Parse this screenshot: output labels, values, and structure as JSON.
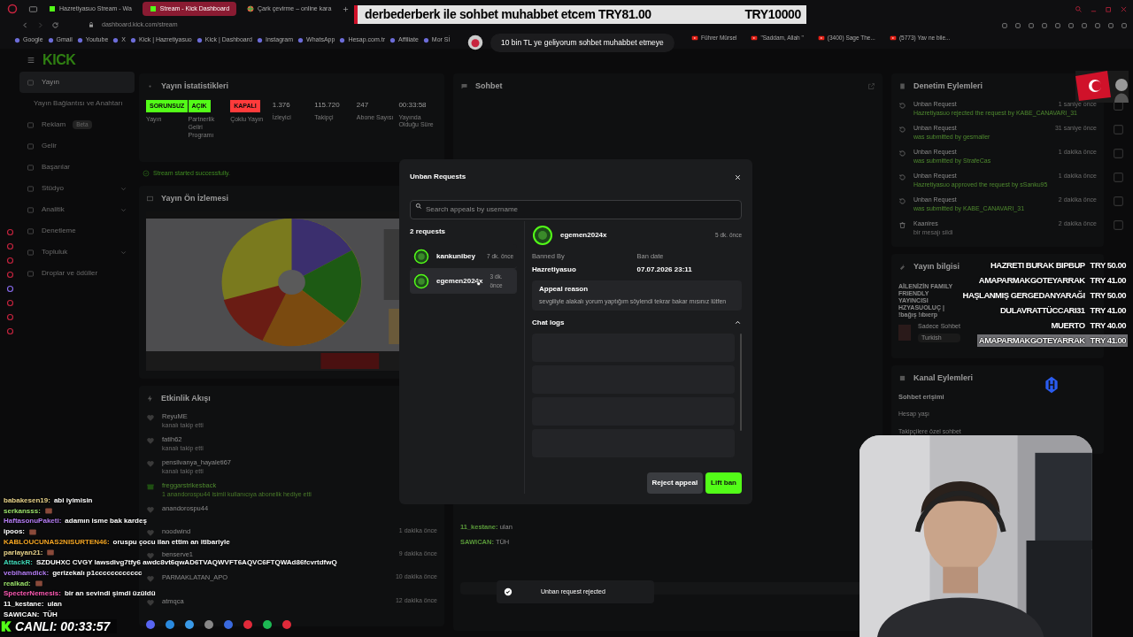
{
  "browser": {
    "tabs": [
      {
        "label": "Hazretiyasuo Stream - Wa",
        "selected": false
      },
      {
        "label": "Stream - Kick Dashboard",
        "selected": true
      },
      {
        "label": "Çark çevirme – online kara",
        "selected": false
      }
    ],
    "address": "dashboard.kick.com/stream",
    "bookmarks": [
      "Google",
      "Gmail",
      "Youtube",
      "X",
      "Kick | Hazretiyasuo",
      "Kick | Dashboard",
      "Instagram",
      "WhatsApp",
      "Hesap.com.tr",
      "Affiliate",
      "Mor Sİ"
    ],
    "video_bookmarks": [
      "Führer Mürsel",
      "\"Saddam, Allah \"",
      "(3400) Sage The...",
      "(5773) Yav ne bile..."
    ]
  },
  "dashboard": {
    "logo": "KICK",
    "sidebar": [
      {
        "label": "Yayın",
        "selected": true,
        "kind": "item"
      },
      {
        "label": "Yayın Bağlantısı ve Anahtarı",
        "selected": false,
        "kind": "sub"
      },
      {
        "label": "Reklam",
        "badge": "Beta",
        "selected": false,
        "kind": "item"
      },
      {
        "label": "Gelir",
        "selected": false,
        "kind": "item"
      },
      {
        "label": "Başarılar",
        "selected": false,
        "kind": "item"
      },
      {
        "label": "Stüdyo",
        "expanded": false,
        "selected": false,
        "kind": "item"
      },
      {
        "label": "Analitik",
        "expanded": false,
        "selected": false,
        "kind": "item"
      },
      {
        "label": "Denetleme",
        "selected": false,
        "kind": "item"
      },
      {
        "label": "Topluluk",
        "expanded": false,
        "selected": false,
        "kind": "item"
      },
      {
        "label": "Droplar ve ödüller",
        "selected": false,
        "kind": "item"
      }
    ],
    "stats": {
      "title": "Yayın İstatistikleri",
      "items": [
        {
          "kind": "badge",
          "value": "SORUNSUZ",
          "color": "#53fc18",
          "label": "Yayın"
        },
        {
          "kind": "badge",
          "value": "AÇIK",
          "color": "#53fc18",
          "label": "Partnerlik Geliri Programı"
        },
        {
          "kind": "badge",
          "value": "KAPALI",
          "color": "#ff3b3b",
          "label": "Çoklu Yayın"
        },
        {
          "kind": "number",
          "value": "1.376",
          "label": "İzleyici"
        },
        {
          "kind": "number",
          "value": "115.720",
          "label": "Takipçi"
        },
        {
          "kind": "number",
          "value": "247",
          "label": "Abone Sayısı"
        },
        {
          "kind": "number",
          "value": "00:33:58",
          "label": "Yayında Olduğu Süre"
        }
      ],
      "notice": "Stream started successfully."
    },
    "preview": {
      "title": "Yayın Ön İzlemesi",
      "kind": "picture"
    },
    "activity": {
      "title": "Etkinlik Akışı",
      "items": [
        {
          "kind": "follow",
          "name": "ReyuME",
          "text": "kanalı takip etti"
        },
        {
          "kind": "follow",
          "name": "fatih62",
          "text": "kanalı takip etti"
        },
        {
          "kind": "follow",
          "name": "pensilvanya_hayaleti67",
          "text": "kanalı takip etti"
        },
        {
          "kind": "gift",
          "name": "freggarstrikesback",
          "text": "1 anandorospu44 isimli kullanıcıya abonelik hediye etti"
        },
        {
          "kind": "follow",
          "name": "anandorospu44"
        },
        {
          "kind": "follow",
          "name": "noodwind",
          "time": "1 dakika önce"
        },
        {
          "kind": "follow",
          "name": "benserve1",
          "time": "9 dakika önce"
        },
        {
          "kind": "follow",
          "name": "PARMAKLATAN_APO",
          "time": "10 dakika önce"
        },
        {
          "kind": "follow",
          "name": "atmqca",
          "time": "12 dakika önce"
        }
      ]
    },
    "chat": {
      "title": "Sohbet",
      "messages": [
        {
          "user": "11_kestane:",
          "text": "ulan"
        },
        {
          "user": "SAWICAN:",
          "text": "TÜH"
        }
      ]
    },
    "moderation": {
      "title": "Denetim Eylemleri",
      "items": [
        {
          "kind": "unban",
          "title": "Unban Request",
          "text": "Hazretiyasuo rejected the request by KABE_CANAVARI_31",
          "time": "1 saniye önce"
        },
        {
          "kind": "unban",
          "title": "Unban Request",
          "text": "was submitted by gesmaller",
          "time": "31 saniye önce"
        },
        {
          "kind": "unban",
          "title": "Unban Request",
          "text": "was submitted by StrafeCas",
          "time": "1 dakika önce"
        },
        {
          "kind": "unban",
          "title": "Unban Request",
          "text": "Hazretiyasuo approved the request by sSanku95",
          "time": "1 dakika önce"
        },
        {
          "kind": "unban",
          "title": "Unban Request",
          "text": "was submitted by KABE_CANAVARI_31",
          "time": "2 dakika önce"
        },
        {
          "kind": "delete",
          "title": "Kaanires",
          "text": "bir mesajı sildi",
          "time": "2 dakika önce"
        }
      ]
    },
    "stream_info": {
      "title": "Yayın bilgisi",
      "stream_title": "AİLENİZİN FAMILY FRIENDLY YAYINCISI HZYASUOLUÇ | !bağış !ıbıerp",
      "category": "Sadece Sohbet",
      "tag": "Turkish"
    },
    "channel_actions": {
      "title": "Kanal Eylemleri",
      "section": "Sohbet erişimi",
      "rows": [
        "Hesap yaşı",
        "Takipçilere özel sohbet"
      ]
    }
  },
  "modal": {
    "title": "Unban Requests",
    "search_placeholder": "Search appeals by username",
    "count": "2 requests",
    "requests": [
      {
        "user": "kankunibey",
        "time": "7 dk. önce",
        "selected": false
      },
      {
        "user": "egemen2024x",
        "time": "3 dk. önce",
        "selected": true
      }
    ],
    "detail": {
      "user": "egemen2024x",
      "time": "5 dk. önce",
      "banned_by_label": "Banned By",
      "banned_by": "Hazretiyasuo",
      "ban_date_label": "Ban date",
      "ban_date": "07.07.2026 23:11",
      "reason_label": "Appeal reason",
      "reason": "sevgiliyle alakalı yorum yaptığım söylendi tekrar bakar mısınız lütfen",
      "chat_logs_label": "Chat logs",
      "chat_logs_expanded": true
    },
    "reject_button": "Reject appeal",
    "lift_button": "Lift ban"
  },
  "toast": "Unban request rejected",
  "overlay": {
    "goal_text": "derbederberk ile sohbet muhabbet etcem TRY81.00",
    "goal_target": "TRY10000",
    "bubble": "10 bin TL ye geliyorum sohbet muhabbet etmeye",
    "donations": [
      {
        "name": "HAZRETI BURAK BIPBUP",
        "amount": "TRY 50.00",
        "highlighted": false
      },
      {
        "name": "AMAPARMAKGOTEYARRAK",
        "amount": "TRY 41.00",
        "highlighted": false
      },
      {
        "name": "HAŞLANMIŞ GERGEDANYARAĞI",
        "amount": "TRY 50.00",
        "highlighted": false
      },
      {
        "name": "DULAVRATTÜCCARI31",
        "amount": "TRY 41.00",
        "highlighted": false
      },
      {
        "name": "MUERTO",
        "amount": "TRY 40.00",
        "highlighted": false
      },
      {
        "name": "AMAPARMAKGOTEYARRAK",
        "amount": "TRY 41.00",
        "highlighted": true
      }
    ],
    "chat": [
      {
        "user": "babakesen19:",
        "text": "abi iyimisin",
        "color": "#e8d38a"
      },
      {
        "user": "serkansss:",
        "emote": true,
        "color": "#9be36b"
      },
      {
        "user": "HaftasonuPaketi:",
        "text": "adamın isme bak kardeş",
        "color": "#b37cf2"
      },
      {
        "user": "ipoos:",
        "emote": true,
        "color": "#ffffff"
      },
      {
        "user": "KABLOUCUNAS2NISURTEN46:",
        "text": "oruspu çocu ilan ettim an itibariyle",
        "color": "#f5a623"
      },
      {
        "user": "parlayan21:",
        "emote": true,
        "color": "#e8d38a"
      },
      {
        "user": "AttackR:",
        "text": "SZDUHXC CVGY lawsdivg7tfy6 awdc8vt6qwAD6TVAQWVFT6AQVC6FTQWAd86fcvrtdfwQ",
        "color": "#3fd6b5"
      },
      {
        "user": "vebihamdick:",
        "text": "gerizekalı p1cccccccccccc",
        "color": "#b37cf2"
      },
      {
        "user": "realkad:",
        "emote": true,
        "color": "#9be36b"
      },
      {
        "user": "SpecterNemesis:",
        "text": "bir an sevindi şimdi üzüldü",
        "color": "#ff5ab4"
      },
      {
        "user": "11_kestane:",
        "text": "ulan",
        "color": "#ffffff"
      },
      {
        "user": "SAWICAN:",
        "text": "TÜH",
        "color": "#ffffff"
      }
    ],
    "live_timer": "CANLI: 00:33:57"
  }
}
